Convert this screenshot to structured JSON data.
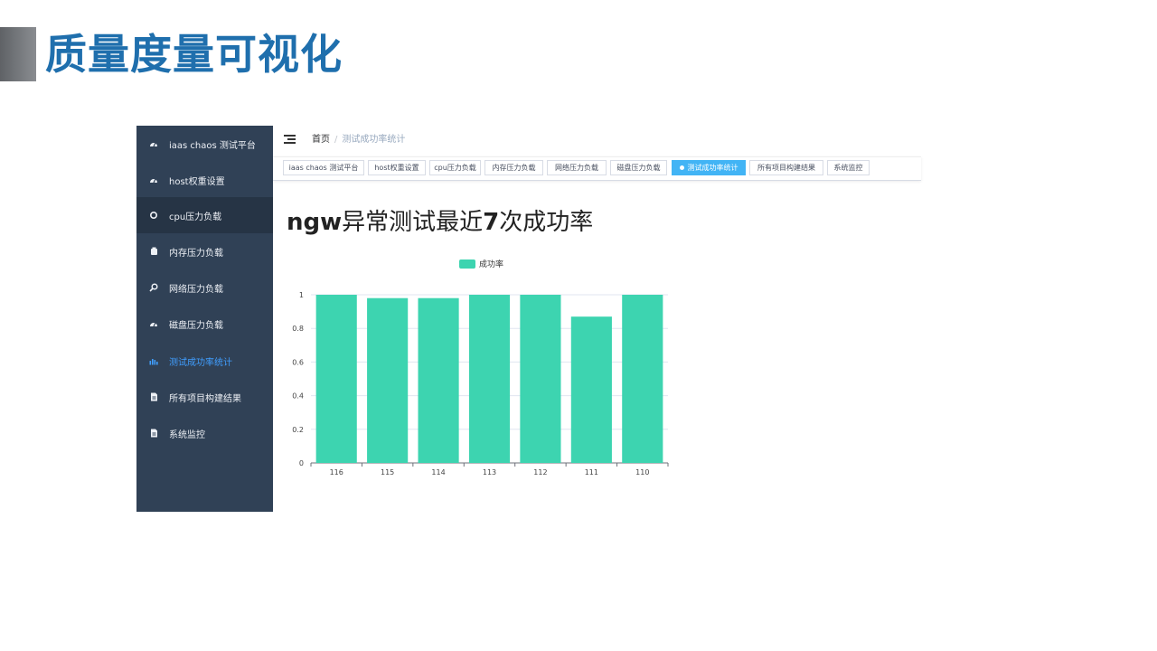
{
  "slide": {
    "title": "质量度量可视化"
  },
  "sidebar": {
    "items": [
      {
        "label": "iaas chaos 测试平台",
        "icon": "dashboard-icon"
      },
      {
        "label": "host权重设置",
        "icon": "dashboard-icon"
      },
      {
        "label": "cpu压力负载",
        "icon": "gear-icon"
      },
      {
        "label": "内存压力负载",
        "icon": "memory-icon"
      },
      {
        "label": "网络压力负载",
        "icon": "search-icon"
      },
      {
        "label": "磁盘压力负载",
        "icon": "dashboard-icon"
      },
      {
        "label": "测试成功率统计",
        "icon": "bar-chart-icon"
      },
      {
        "label": "所有项目构建结果",
        "icon": "document-icon"
      },
      {
        "label": "系统监控",
        "icon": "document-icon"
      }
    ]
  },
  "breadcrumb": {
    "home": "首页",
    "separator": "/",
    "current": "测试成功率统计"
  },
  "tags": [
    "iaas chaos 测试平台",
    "host权重设置",
    "cpu压力负载",
    "内存压力负载",
    "网络压力负载",
    "磁盘压力负载",
    "测试成功率统计",
    "所有项目构建结果",
    "系统监控"
  ],
  "colors": {
    "sidebar_bg": "#304156",
    "accent": "#409eff",
    "bar": "#3dd4b0",
    "title_blue": "#1f6fad"
  },
  "chart_data": {
    "type": "bar",
    "title_prefix": "ngw",
    "title_mid": "异常测试最近",
    "title_num": "7",
    "title_suffix": "次成功率",
    "legend": "成功率",
    "categories": [
      "116",
      "115",
      "114",
      "113",
      "112",
      "111",
      "110"
    ],
    "values": [
      1,
      0.98,
      0.98,
      1,
      1,
      0.87,
      1
    ],
    "yticks": [
      "0",
      "0.2",
      "0.4",
      "0.6",
      "0.8",
      "1"
    ],
    "ylim": [
      0,
      1
    ]
  }
}
